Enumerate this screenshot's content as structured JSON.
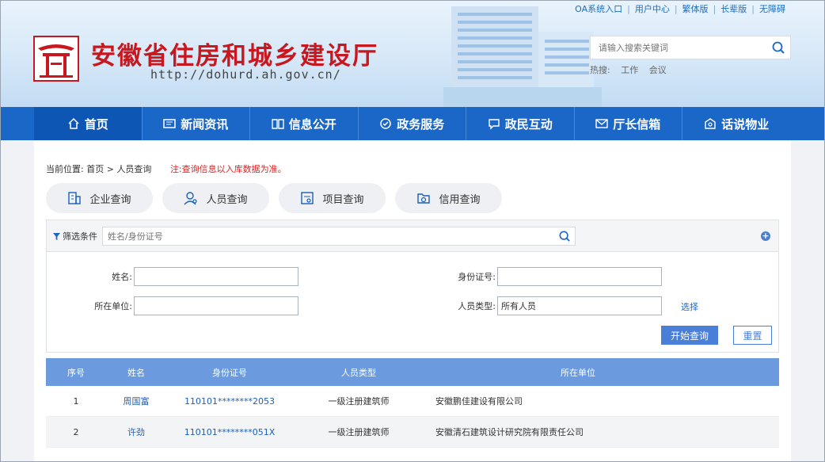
{
  "top_links": [
    "OA系统入口",
    "用户中心",
    "繁体版",
    "长辈版",
    "无障碍"
  ],
  "site": {
    "title": "安徽省住房和城乡建设厅",
    "url": "http://dohurd.ah.gov.cn/"
  },
  "search": {
    "placeholder": "请输入搜索关键词",
    "hot_label": "热搜:",
    "hot_words": [
      "工作",
      "会议"
    ]
  },
  "nav": [
    {
      "label": "首页",
      "icon": "home-icon"
    },
    {
      "label": "新闻资讯",
      "icon": "news-icon"
    },
    {
      "label": "信息公开",
      "icon": "book-icon"
    },
    {
      "label": "政务服务",
      "icon": "service-icon"
    },
    {
      "label": "政民互动",
      "icon": "chat-icon"
    },
    {
      "label": "厅长信箱",
      "icon": "mail-icon"
    },
    {
      "label": "话说物业",
      "icon": "property-icon"
    }
  ],
  "breadcrumb": {
    "prefix": "当前位置:",
    "home": "首页",
    "sep": ">",
    "current": "人员查询",
    "note": "注:查询信息以入库数据为准。"
  },
  "query_tabs": [
    {
      "label": "企业查询",
      "icon": "company-icon"
    },
    {
      "label": "人员查询",
      "icon": "person-icon"
    },
    {
      "label": "项目查询",
      "icon": "project-icon"
    },
    {
      "label": "信用查询",
      "icon": "credit-icon"
    }
  ],
  "filter": {
    "label": "筛选条件",
    "placeholder": "姓名/身份证号",
    "name_label": "姓名:",
    "id_label": "身份证号:",
    "unit_label": "所在单位:",
    "type_label": "人员类型:",
    "type_value": "所有人员",
    "select_label": "选择",
    "start_label": "开始查询",
    "reset_label": "重置"
  },
  "table": {
    "headers": [
      "序号",
      "姓名",
      "身份证号",
      "人员类型",
      "所在单位"
    ],
    "rows": [
      [
        "1",
        "周国富",
        "110101********2053",
        "一级注册建筑师",
        "安徽鹏佳建设有限公司"
      ],
      [
        "2",
        "许劲",
        "110101********051X",
        "一级注册建筑师",
        "安徽清石建筑设计研究院有限责任公司"
      ]
    ]
  },
  "colors": {
    "nav_bg": "#1a67c8",
    "title_red": "#c8171e",
    "table_header": "#6b9bde",
    "note_red": "#e02020"
  }
}
